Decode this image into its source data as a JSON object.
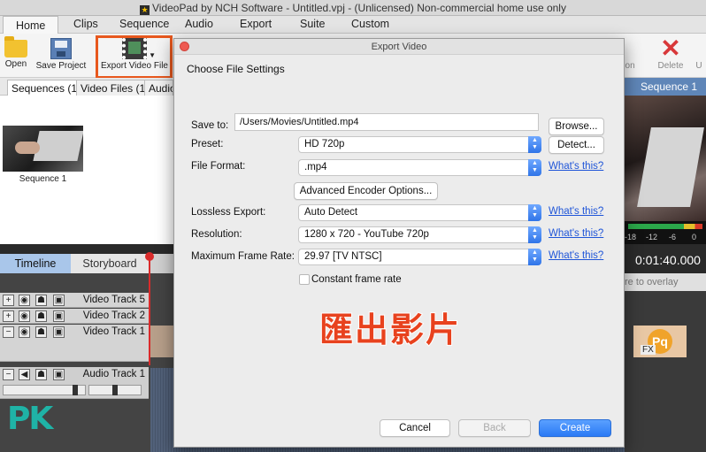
{
  "window": {
    "title": "VideoPad by NCH Software - Untitled.vpj - (Unlicensed) Non-commercial home use only"
  },
  "menu_tabs": [
    "Home",
    "Clips",
    "Sequence",
    "Audio",
    "Export",
    "Suite",
    "Custom"
  ],
  "ribbon": {
    "open": "Open",
    "save_project": "Save Project",
    "export_video_file": "Export Video File",
    "right_partial": "ion",
    "delete": "Delete",
    "right_edge": "U"
  },
  "bins": {
    "tabs": [
      "Sequences (1)",
      "Video Files (1)",
      "Audio"
    ],
    "items": [
      {
        "label": "Sequence 1"
      }
    ]
  },
  "preview": {
    "header": "Sequence 1",
    "vu_labels": [
      "-18",
      "-12",
      "-6",
      "0"
    ],
    "time": "0:01:40.000",
    "overlay_hint": "re to overlay"
  },
  "timeline": {
    "tabs": [
      "Timeline",
      "Storyboard"
    ],
    "tracks": [
      {
        "name": "Video Track 5",
        "toggle": "+"
      },
      {
        "name": "Video Track 2",
        "toggle": "+"
      },
      {
        "name": "Video Track 1",
        "toggle": "−"
      },
      {
        "name": "Audio Track 1",
        "toggle": "−"
      }
    ],
    "fx_tag": "FX",
    "clip_badge": "Pq"
  },
  "dialog": {
    "title": "Export Video",
    "heading": "Choose File Settings",
    "save_to": {
      "label": "Save to:",
      "value": "/Users/Movies/Untitled.mp4",
      "browse": "Browse..."
    },
    "preset": {
      "label": "Preset:",
      "value": "HD 720p",
      "detect": "Detect..."
    },
    "file_format": {
      "label": "File Format:",
      "value": ".mp4",
      "help": "What's this?"
    },
    "advanced": "Advanced Encoder Options...",
    "lossless": {
      "label": "Lossless Export:",
      "value": "Auto Detect",
      "help": "What's this?"
    },
    "resolution": {
      "label": "Resolution:",
      "value": "1280 x 720 - YouTube 720p",
      "help": "What's this?"
    },
    "frame_rate": {
      "label": "Maximum Frame Rate:",
      "value": "29.97 [TV NTSC]",
      "help": "What's this?"
    },
    "constant_frame_rate": {
      "label": "Constant frame rate",
      "checked": false
    },
    "buttons": {
      "cancel": "Cancel",
      "back": "Back",
      "create": "Create"
    }
  },
  "annotation": {
    "caption": "匯出影片",
    "watermark": "PK"
  },
  "colors": {
    "highlight": "#e8581e",
    "accent_blue": "#2a7af5",
    "link": "#1f55d8",
    "caption": "#e8421e"
  }
}
